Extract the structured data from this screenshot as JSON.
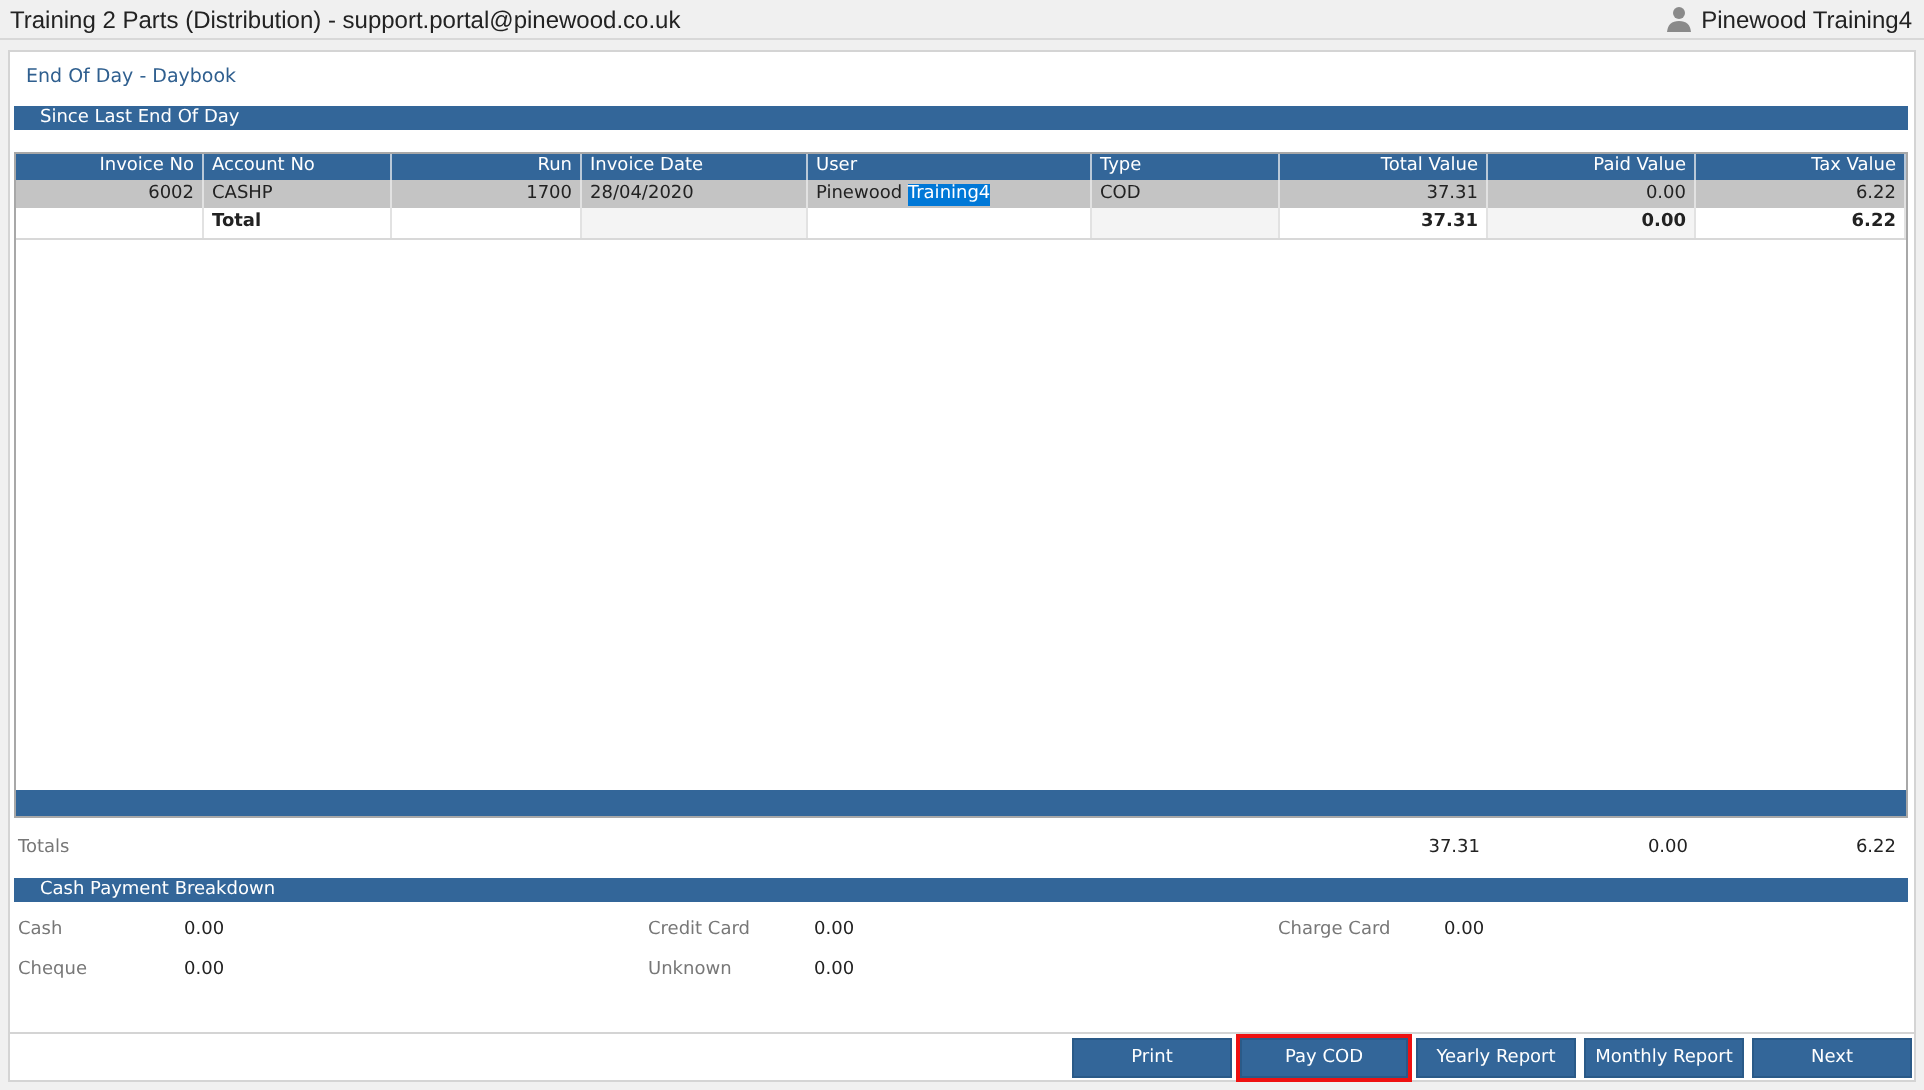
{
  "window": {
    "title": "Training 2 Parts (Distribution) - support.portal@pinewood.co.uk",
    "user": "Pinewood Training4"
  },
  "page_title": "End Of Day - Daybook",
  "section": "Since Last End Of Day",
  "table": {
    "columns": [
      {
        "label": "Invoice No"
      },
      {
        "label": "Account No"
      },
      {
        "label": "Run"
      },
      {
        "label": "Invoice Date"
      },
      {
        "label": "User"
      },
      {
        "label": "Type"
      },
      {
        "label": "Total Value"
      },
      {
        "label": "Paid Value"
      },
      {
        "label": "Tax Value"
      }
    ],
    "rows": [
      {
        "selected": true,
        "cells": [
          {
            "text": "6002"
          },
          {
            "text": "CASHP"
          },
          {
            "text": "1700"
          },
          {
            "text": "28/04/2020"
          },
          {
            "text": "Pinewood ",
            "highlighted_text": "Training4"
          },
          {
            "text": "COD"
          },
          {
            "text": "37.31"
          },
          {
            "text": "0.00"
          },
          {
            "text": "6.22"
          }
        ]
      }
    ],
    "total_row": {
      "label": "Total",
      "total_value": "37.31",
      "paid_value": "0.00",
      "tax_value": "6.22"
    }
  },
  "totals": {
    "label": "Totals",
    "total_value": "37.31",
    "paid_value": "0.00",
    "tax_value": "6.22"
  },
  "breakdown": {
    "title": "Cash Payment Breakdown",
    "fields": [
      {
        "label": "Cash",
        "value": "0.00"
      },
      {
        "label": "Credit Card",
        "value": "0.00"
      },
      {
        "label": "Charge Card",
        "value": "0.00"
      },
      {
        "label": "Cheque",
        "value": "0.00"
      },
      {
        "label": "Unknown",
        "value": "0.00"
      }
    ]
  },
  "buttons": [
    {
      "label": "Print",
      "highlighted": false
    },
    {
      "label": "Pay COD",
      "highlighted": true
    },
    {
      "label": "Yearly Report",
      "highlighted": false
    },
    {
      "label": "Monthly Report",
      "highlighted": false
    },
    {
      "label": "Next",
      "highlighted": false
    }
  ]
}
